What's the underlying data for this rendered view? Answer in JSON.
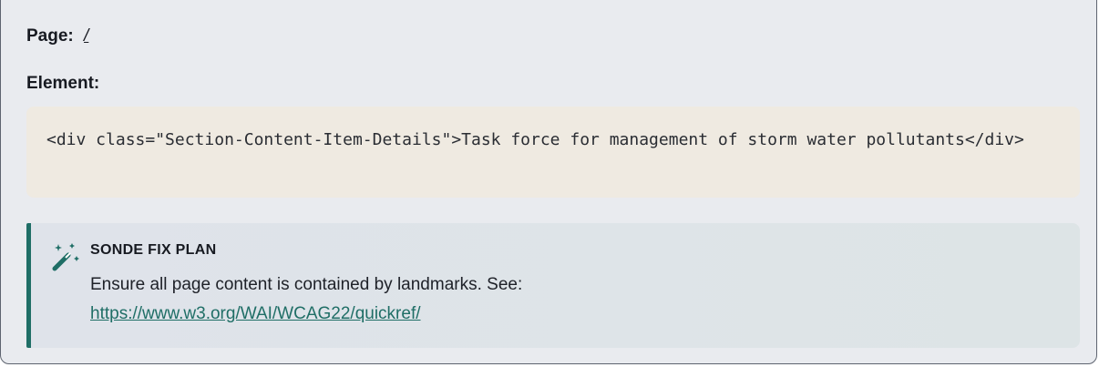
{
  "issue": {
    "page_label": "Page:",
    "page_value": "/",
    "element_label": "Element:",
    "element_code": "<div class=\"Section-Content-Item-Details\">Task force for management of storm water pollutants</div>"
  },
  "fix_plan": {
    "icon": "magic-wand-icon",
    "title": "SONDE FIX PLAN",
    "text": "Ensure all page content is contained by landmarks. See:",
    "link": "https://www.w3.org/WAI/WCAG22/quickref/"
  },
  "colors": {
    "accent": "#1f6e66",
    "card_bg": "#e9ebef",
    "code_bg": "#efeae1"
  }
}
